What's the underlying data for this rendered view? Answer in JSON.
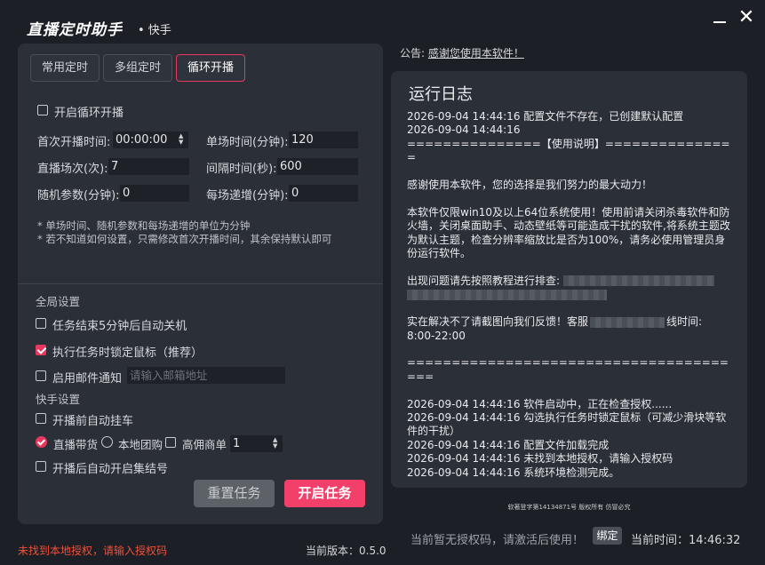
{
  "app": {
    "title": "直播定时助手",
    "subtitle": "• 快手"
  },
  "tabs": [
    {
      "label": "常用定时"
    },
    {
      "label": "多组定时"
    },
    {
      "label": "循环开播"
    }
  ],
  "loop": {
    "enable_label": "开启循环开播",
    "first_time_label": "首次开播时间:",
    "first_time_value": "00:00:00",
    "duration_label": "单场时间(分钟):",
    "duration_value": "120",
    "count_label": "直播场次(次):",
    "count_value": "7",
    "interval_label": "间隔时间(秒):",
    "interval_value": "600",
    "random_label": "随机参数(分钟):",
    "random_value": "0",
    "increment_label": "每场递增(分钟):",
    "increment_value": "0",
    "note1": "* 单场时间、随机参数和每场递增的单位为分钟",
    "note2": "* 若不知道如何设置，只需修改首次开播时间，其余保持默认即可"
  },
  "global": {
    "section_label": "全局设置",
    "shutdown_label": "任务结束5分钟后自动关机",
    "lock_mouse_label": "执行任务时锁定鼠标（推荐）",
    "email_label": "启用邮件通知",
    "email_placeholder": "请输入邮箱地址"
  },
  "quick": {
    "section_label": "快手设置",
    "cart_label": "开播前自动挂车",
    "mode_goods_label": "直播带货",
    "mode_group_label": "本地团购",
    "mode_commission_label": "高佣商单",
    "commission_value": "1",
    "gather_label": "开播后自动开启集结号"
  },
  "buttons": {
    "reset": "重置任务",
    "start": "开启任务"
  },
  "status": {
    "error": "未找到本地授权，请输入授权码",
    "version": "当前版本：0.5.0"
  },
  "notice": {
    "prefix": "公告:",
    "link": "感谢您使用本软件！"
  },
  "log": {
    "title": "运行日志",
    "lines": [
      "2026-09-04 14:44:16 配置文件不存在，已创建默认配置",
      "2026-09-04 14:44:16",
      "===============【使用说明】===============",
      "",
      "感谢使用本软件，您的选择是我们努力的最大动力！",
      "",
      "本软件仅限win10及以上64位系统使用！使用前请关闭杀毒软件和防火墙，关闭桌面助手、动态壁纸等可能造成干扰的软件,将系统主题改为默认主题，检查分辨率缩放比是否为100%，请务必使用管理员身份运行软件。",
      "",
      "出现问题请先按照教程进行排查:",
      "",
      "",
      "实在解决不了请截图向我们反馈！客服",
      "8:00-22:00",
      "",
      "=======================================",
      "",
      "2026-09-04 14:44:16 软件启动中，正在检查授权......",
      "2026-09-04 14:44:16 勾选执行任务时锁定鼠标（可减少滑块等软件的干扰）",
      "2026-09-04 14:44:16 配置文件加载完成",
      "2026-09-04 14:44:16 未找到本地授权，请输入授权码",
      "2026-09-04 14:44:16 系统环境检测完成。"
    ],
    "service_suffix": "线时间:"
  },
  "footer": {
    "copyright": "软著登字第14134871号 版权所有 仿冒必究",
    "auth_tip": "当前暂无授权码，请激活后使用！",
    "bind": "绑定",
    "time_label": "当前时间：",
    "time_value": "14:46:32"
  },
  "colors": {
    "accent": "#e8385e",
    "start_button": "#f2406a",
    "error": "#f0503a"
  }
}
